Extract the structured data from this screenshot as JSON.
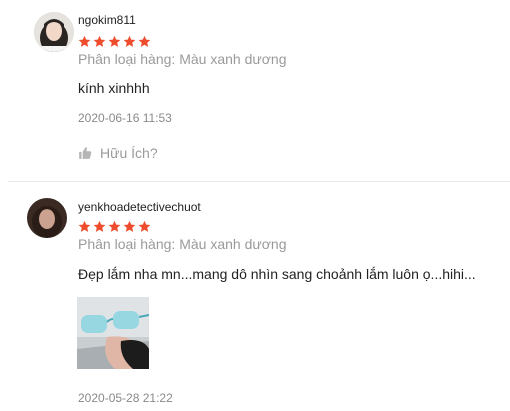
{
  "reviews": [
    {
      "username": "ngokim811",
      "rating": 5,
      "variation": "Phân loại hàng: Màu xanh dương",
      "comment": "kính xinhhh",
      "time": "2020-06-16 11:53",
      "helpful_label": "Hữu Ích?"
    },
    {
      "username": "yenkhoadetectivechuot",
      "rating": 5,
      "variation": "Phân loại hàng: Màu xanh dương",
      "comment": "Đẹp lắm nha mn...mang dô nhìn sang choảnh lắm luôn ọ...hihi...",
      "time": "2020-05-28 21:22"
    }
  ],
  "colors": {
    "star": "#ee4d2d",
    "divider": "#e8e8e8"
  }
}
